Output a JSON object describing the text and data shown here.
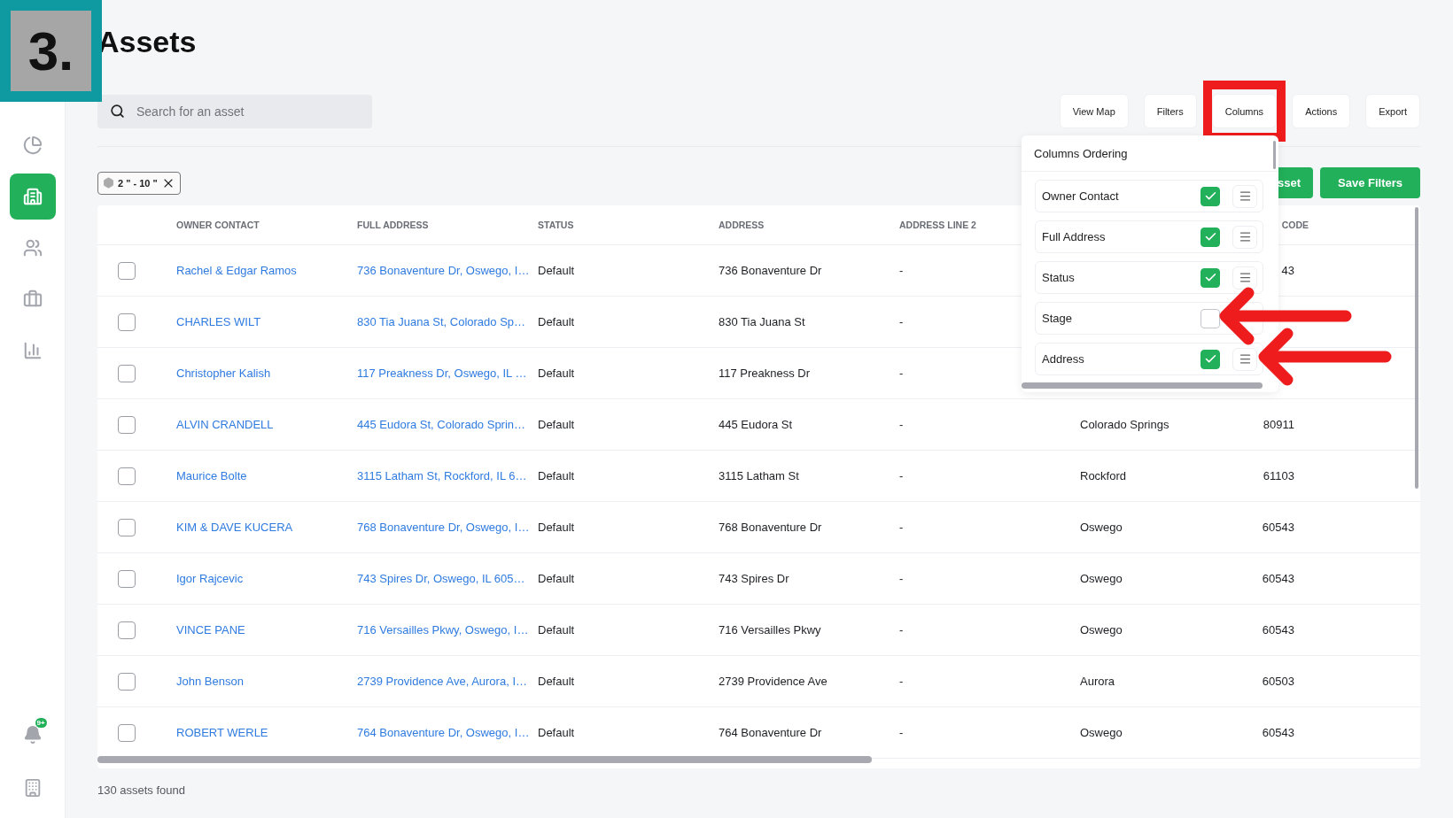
{
  "step_badge": "3.",
  "sidebar": {
    "items": [
      {
        "selected": false
      },
      {
        "selected": true
      },
      {
        "selected": false
      },
      {
        "selected": false
      },
      {
        "selected": false
      }
    ],
    "notification_badge": "9+"
  },
  "title": "Assets",
  "search": {
    "placeholder": "Search for an asset"
  },
  "toolbar": [
    {
      "label": "View Map",
      "highlighted": false
    },
    {
      "label": "Filters",
      "highlighted": false
    },
    {
      "label": "Columns",
      "highlighted": true
    },
    {
      "label": "Actions",
      "highlighted": false
    },
    {
      "label": "Export",
      "highlighted": false
    }
  ],
  "filter_chip": {
    "label": "2 \" - 10 \""
  },
  "green_buttons": [
    "sset",
    "Save Filters"
  ],
  "table": {
    "columns": [
      {
        "label": "OWNER CONTACT",
        "kind": "link"
      },
      {
        "label": "FULL ADDRESS",
        "kind": "link"
      },
      {
        "label": "STATUS",
        "kind": "text"
      },
      {
        "label": "ADDRESS",
        "kind": "text"
      },
      {
        "label": "ADDRESS LINE 2",
        "kind": "text"
      },
      {
        "kind": "text"
      },
      {
        "label": "CODE",
        "kind": "text"
      }
    ],
    "rows": [
      {
        "checked": false,
        "cells": [
          "Rachel & Edgar Ramos",
          "736 Bonaventure Dr, Oswego, I…",
          "Default",
          "736 Bonaventure Dr",
          "-",
          null,
          "43"
        ]
      },
      {
        "checked": false,
        "cells": [
          "CHARLES WILT",
          "830 Tia Juana St, Colorado Sp…",
          "Default",
          "830 Tia Juana St",
          "-",
          null,
          null
        ]
      },
      {
        "checked": false,
        "cells": [
          "Christopher Kalish",
          "117 Preakness Dr, Oswego, IL …",
          "Default",
          "117 Preakness Dr",
          "-",
          null,
          null
        ]
      },
      {
        "checked": false,
        "cells": [
          "ALVIN CRANDELL",
          "445 Eudora St, Colorado Sprin…",
          "Default",
          "445 Eudora St",
          "-",
          "Colorado Springs",
          "80911"
        ]
      },
      {
        "checked": false,
        "cells": [
          "Maurice Bolte",
          "3115 Latham St, Rockford, IL 6…",
          "Default",
          "3115 Latham St",
          "-",
          "Rockford",
          "61103"
        ]
      },
      {
        "checked": false,
        "cells": [
          "KIM & DAVE KUCERA",
          "768 Bonaventure Dr, Oswego, I…",
          "Default",
          "768 Bonaventure Dr",
          "-",
          "Oswego",
          "60543"
        ]
      },
      {
        "checked": false,
        "cells": [
          "Igor Rajcevic",
          "743 Spires Dr, Oswego, IL 605…",
          "Default",
          "743 Spires Dr",
          "-",
          "Oswego",
          "60543"
        ]
      },
      {
        "checked": false,
        "cells": [
          "VINCE PANE",
          "716 Versailles Pkwy, Oswego, I…",
          "Default",
          "716 Versailles Pkwy",
          "-",
          "Oswego",
          "60543"
        ]
      },
      {
        "checked": false,
        "cells": [
          "John Benson",
          "2739 Providence Ave, Aurora, I…",
          "Default",
          "2739 Providence Ave",
          "-",
          "Aurora",
          "60503"
        ]
      },
      {
        "checked": false,
        "cells": [
          "ROBERT WERLE",
          "764 Bonaventure Dr, Oswego, I…",
          "Default",
          "764 Bonaventure Dr",
          "-",
          "Oswego",
          "60543"
        ]
      }
    ]
  },
  "footer": "130 assets found",
  "columns_menu": {
    "title": "Columns Ordering",
    "items": [
      {
        "label": "Owner Contact",
        "checked": true,
        "handle": true
      },
      {
        "label": "Full Address",
        "checked": true,
        "handle": true
      },
      {
        "label": "Status",
        "checked": true,
        "handle": true
      },
      {
        "label": "Stage",
        "checked": false,
        "handle": false
      },
      {
        "label": "Address",
        "checked": true,
        "handle": true
      }
    ]
  }
}
